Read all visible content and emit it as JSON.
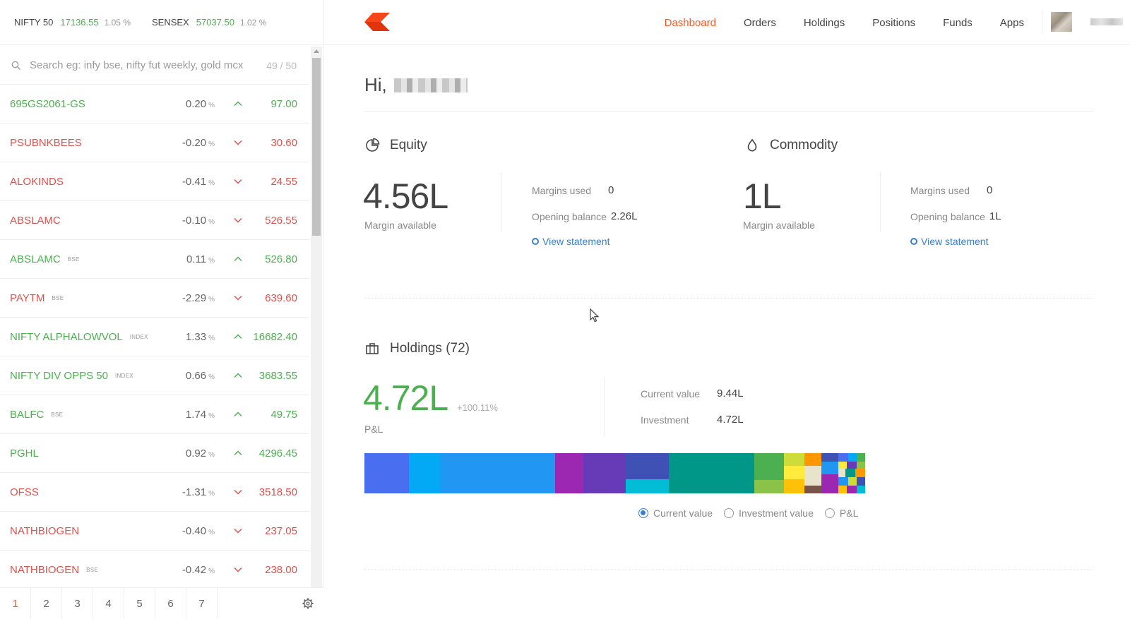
{
  "indices": [
    {
      "name": "NIFTY 50",
      "value": "17136.55",
      "change": "1.05 %"
    },
    {
      "name": "SENSEX",
      "value": "57037.50",
      "change": "1.02 %"
    }
  ],
  "search": {
    "placeholder": "Search eg: infy bse, nifty fut weekly, gold mcx",
    "count": "49 / 50"
  },
  "watchlist": [
    {
      "symbol": "695GS2061-GS",
      "tag": "",
      "change": "0.20",
      "pct": "%",
      "ltp": "97.00",
      "dir": "up"
    },
    {
      "symbol": "PSUBNKBEES",
      "tag": "",
      "change": "-0.20",
      "pct": "%",
      "ltp": "30.60",
      "dir": "down"
    },
    {
      "symbol": "ALOKINDS",
      "tag": "",
      "change": "-0.41",
      "pct": "%",
      "ltp": "24.55",
      "dir": "down"
    },
    {
      "symbol": "ABSLAMC",
      "tag": "",
      "change": "-0.10",
      "pct": "%",
      "ltp": "526.55",
      "dir": "down"
    },
    {
      "symbol": "ABSLAMC",
      "tag": "BSE",
      "change": "0.11",
      "pct": "%",
      "ltp": "526.80",
      "dir": "up"
    },
    {
      "symbol": "PAYTM",
      "tag": "BSE",
      "change": "-2.29",
      "pct": "%",
      "ltp": "639.60",
      "dir": "down"
    },
    {
      "symbol": "NIFTY ALPHALOWVOL",
      "tag": "INDEX",
      "change": "1.33",
      "pct": "%",
      "ltp": "16682.40",
      "dir": "up"
    },
    {
      "symbol": "NIFTY DIV OPPS 50",
      "tag": "INDEX",
      "change": "0.66",
      "pct": "%",
      "ltp": "3683.55",
      "dir": "up"
    },
    {
      "symbol": "BALFC",
      "tag": "BSE",
      "change": "1.74",
      "pct": "%",
      "ltp": "49.75",
      "dir": "up"
    },
    {
      "symbol": "PGHL",
      "tag": "",
      "change": "0.92",
      "pct": "%",
      "ltp": "4296.45",
      "dir": "up"
    },
    {
      "symbol": "OFSS",
      "tag": "",
      "change": "-1.31",
      "pct": "%",
      "ltp": "3518.50",
      "dir": "down"
    },
    {
      "symbol": "NATHBIOGEN",
      "tag": "",
      "change": "-0.40",
      "pct": "%",
      "ltp": "237.05",
      "dir": "down"
    },
    {
      "symbol": "NATHBIOGEN",
      "tag": "BSE",
      "change": "-0.42",
      "pct": "%",
      "ltp": "238.00",
      "dir": "down"
    }
  ],
  "pages": [
    "1",
    "2",
    "3",
    "4",
    "5",
    "6",
    "7"
  ],
  "nav": [
    "Dashboard",
    "Orders",
    "Holdings",
    "Positions",
    "Funds",
    "Apps"
  ],
  "greeting": "Hi,",
  "equity": {
    "title": "Equity",
    "margin_available": "4.56L",
    "margin_label": "Margin available",
    "margins_used_label": "Margins used",
    "margins_used": "0",
    "opening_balance_label": "Opening balance",
    "opening_balance": "2.26L",
    "view_statement": "View statement"
  },
  "commodity": {
    "title": "Commodity",
    "margin_available": "1L",
    "margin_label": "Margin available",
    "margins_used_label": "Margins used",
    "margins_used": "0",
    "opening_balance_label": "Opening balance",
    "opening_balance": "1L",
    "view_statement": "View statement"
  },
  "holdings": {
    "title": "Holdings (72)",
    "pnl": "4.72L",
    "pnl_pct": "+100.11%",
    "pnl_label": "P&L",
    "current_value_label": "Current value",
    "current_value": "9.44L",
    "investment_label": "Investment",
    "investment": "4.72L",
    "radio_options": [
      "Current value",
      "Investment value",
      "P&L"
    ],
    "selected": "Current value"
  },
  "colors": {
    "accent": "#ff5722",
    "up": "#4caf50",
    "down": "#df514c",
    "link": "#387ed1"
  }
}
